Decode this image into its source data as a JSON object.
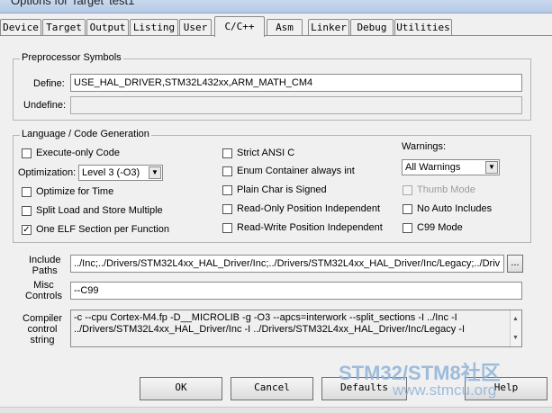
{
  "window": {
    "title": "Options for Target 'test1'"
  },
  "tabs": [
    "Device",
    "Target",
    "Output",
    "Listing",
    "User",
    "C/C++",
    "Asm",
    "Linker",
    "Debug",
    "Utilities"
  ],
  "active_tab": "C/C++",
  "preprocessor": {
    "title": "Preprocessor Symbols",
    "define_label": "Define:",
    "define_value": "USE_HAL_DRIVER,STM32L432xx,ARM_MATH_CM4",
    "undefine_label": "Undefine:",
    "undefine_value": ""
  },
  "codegen": {
    "title": "Language / Code Generation",
    "execute_only": {
      "label": "Execute-only Code",
      "checked": false
    },
    "optimization_label": "Optimization:",
    "optimization_value": "Level 3 (-O3)",
    "optimize_time": {
      "label": "Optimize for Time",
      "checked": false
    },
    "split_load": {
      "label": "Split Load and Store Multiple",
      "checked": false
    },
    "one_elf": {
      "label": "One ELF Section per Function",
      "checked": true
    },
    "strict_ansi": {
      "label": "Strict ANSI C",
      "checked": false
    },
    "enum_container": {
      "label": "Enum Container always int",
      "checked": false
    },
    "plain_char": {
      "label": "Plain Char is Signed",
      "checked": false
    },
    "ro_pi": {
      "label": "Read-Only Position Independent",
      "checked": false
    },
    "rw_pi": {
      "label": "Read-Write Position Independent",
      "checked": false
    },
    "warnings_label": "Warnings:",
    "warnings_value": "All Warnings",
    "thumb_mode": {
      "label": "Thumb Mode",
      "checked": false,
      "disabled": true
    },
    "no_auto_includes": {
      "label": "No Auto Includes",
      "checked": false
    },
    "c99_mode": {
      "label": "C99 Mode",
      "checked": false
    }
  },
  "include_paths": {
    "label_line1": "Include",
    "label_line2": "Paths",
    "value": "../Inc;../Drivers/STM32L4xx_HAL_Driver/Inc;../Drivers/STM32L4xx_HAL_Driver/Inc/Legacy;../Driv",
    "browse_label": "..."
  },
  "misc_controls": {
    "label_line1": "Misc",
    "label_line2": "Controls",
    "value": "--C99"
  },
  "compiler_string": {
    "label_line1": "Compiler",
    "label_line2": "control",
    "label_line3": "string",
    "line1": "-c --cpu Cortex-M4.fp -D__MICROLIB -g -O3 --apcs=interwork --split_sections -I ../Inc -I",
    "line2": "../Drivers/STM32L4xx_HAL_Driver/Inc -I ../Drivers/STM32L4xx_HAL_Driver/Inc/Legacy -I"
  },
  "buttons": {
    "ok": "OK",
    "cancel": "Cancel",
    "defaults": "Defaults",
    "help": "Help"
  },
  "watermark": {
    "line1": "STM32/STM8社区",
    "line2": "www.stmcu.org"
  }
}
